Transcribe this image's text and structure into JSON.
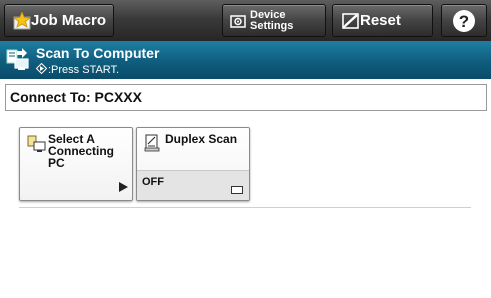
{
  "toolbar": {
    "job_macro_label": "Job Macro",
    "device_settings_line1": "Device",
    "device_settings_line2": "Settings",
    "reset_label": "Reset",
    "help_symbol": "?"
  },
  "header": {
    "title": "Scan To Computer",
    "subtitle": ":Press START."
  },
  "connect": {
    "label": "Connect To: PCXXX"
  },
  "functions": [
    {
      "label": "Select A Connecting PC",
      "value": ""
    },
    {
      "label": "Duplex Scan",
      "value": "OFF"
    }
  ],
  "colors": {
    "toolbar": "#333333",
    "titlebar": "#0f5d7e",
    "tile_background": "#f2f2f2"
  }
}
